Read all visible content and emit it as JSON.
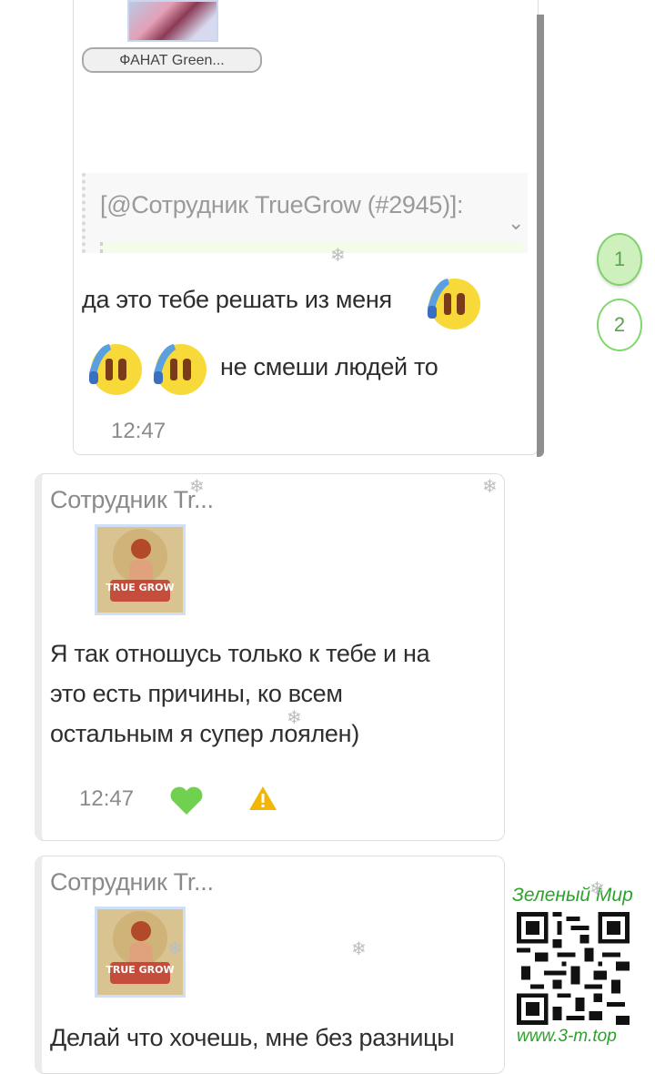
{
  "message_top": {
    "author": "ФАНАТ Green...",
    "quote": "[@Сотрудник TrueGrow (#2945)]:",
    "line1": "да это тебе решать из меня",
    "line2": "не смеши людей то",
    "time": "12:47"
  },
  "pagination": [
    "1",
    "2"
  ],
  "message_2": {
    "author": "Сотрудник Tr...",
    "avatar_caption": "TRUE GROW",
    "lines": [
      "Я так отношусь только к тебе и на",
      "это есть причины, ко всем",
      "остальным я супер лоялен)"
    ],
    "time": "12:47",
    "icons": [
      "heart-icon",
      "warning-icon"
    ]
  },
  "message_3": {
    "author": "Сотрудник Tr...",
    "avatar_caption": "TRUE GROW",
    "line1": "Делай что хочешь, мне без разницы"
  },
  "watermark": {
    "title": "Зеленый Мир",
    "url": "www.3-m.top"
  },
  "colors": {
    "accent_green": "#7fd86b",
    "heart": "#6fd14f",
    "warning": "#f2b705"
  }
}
